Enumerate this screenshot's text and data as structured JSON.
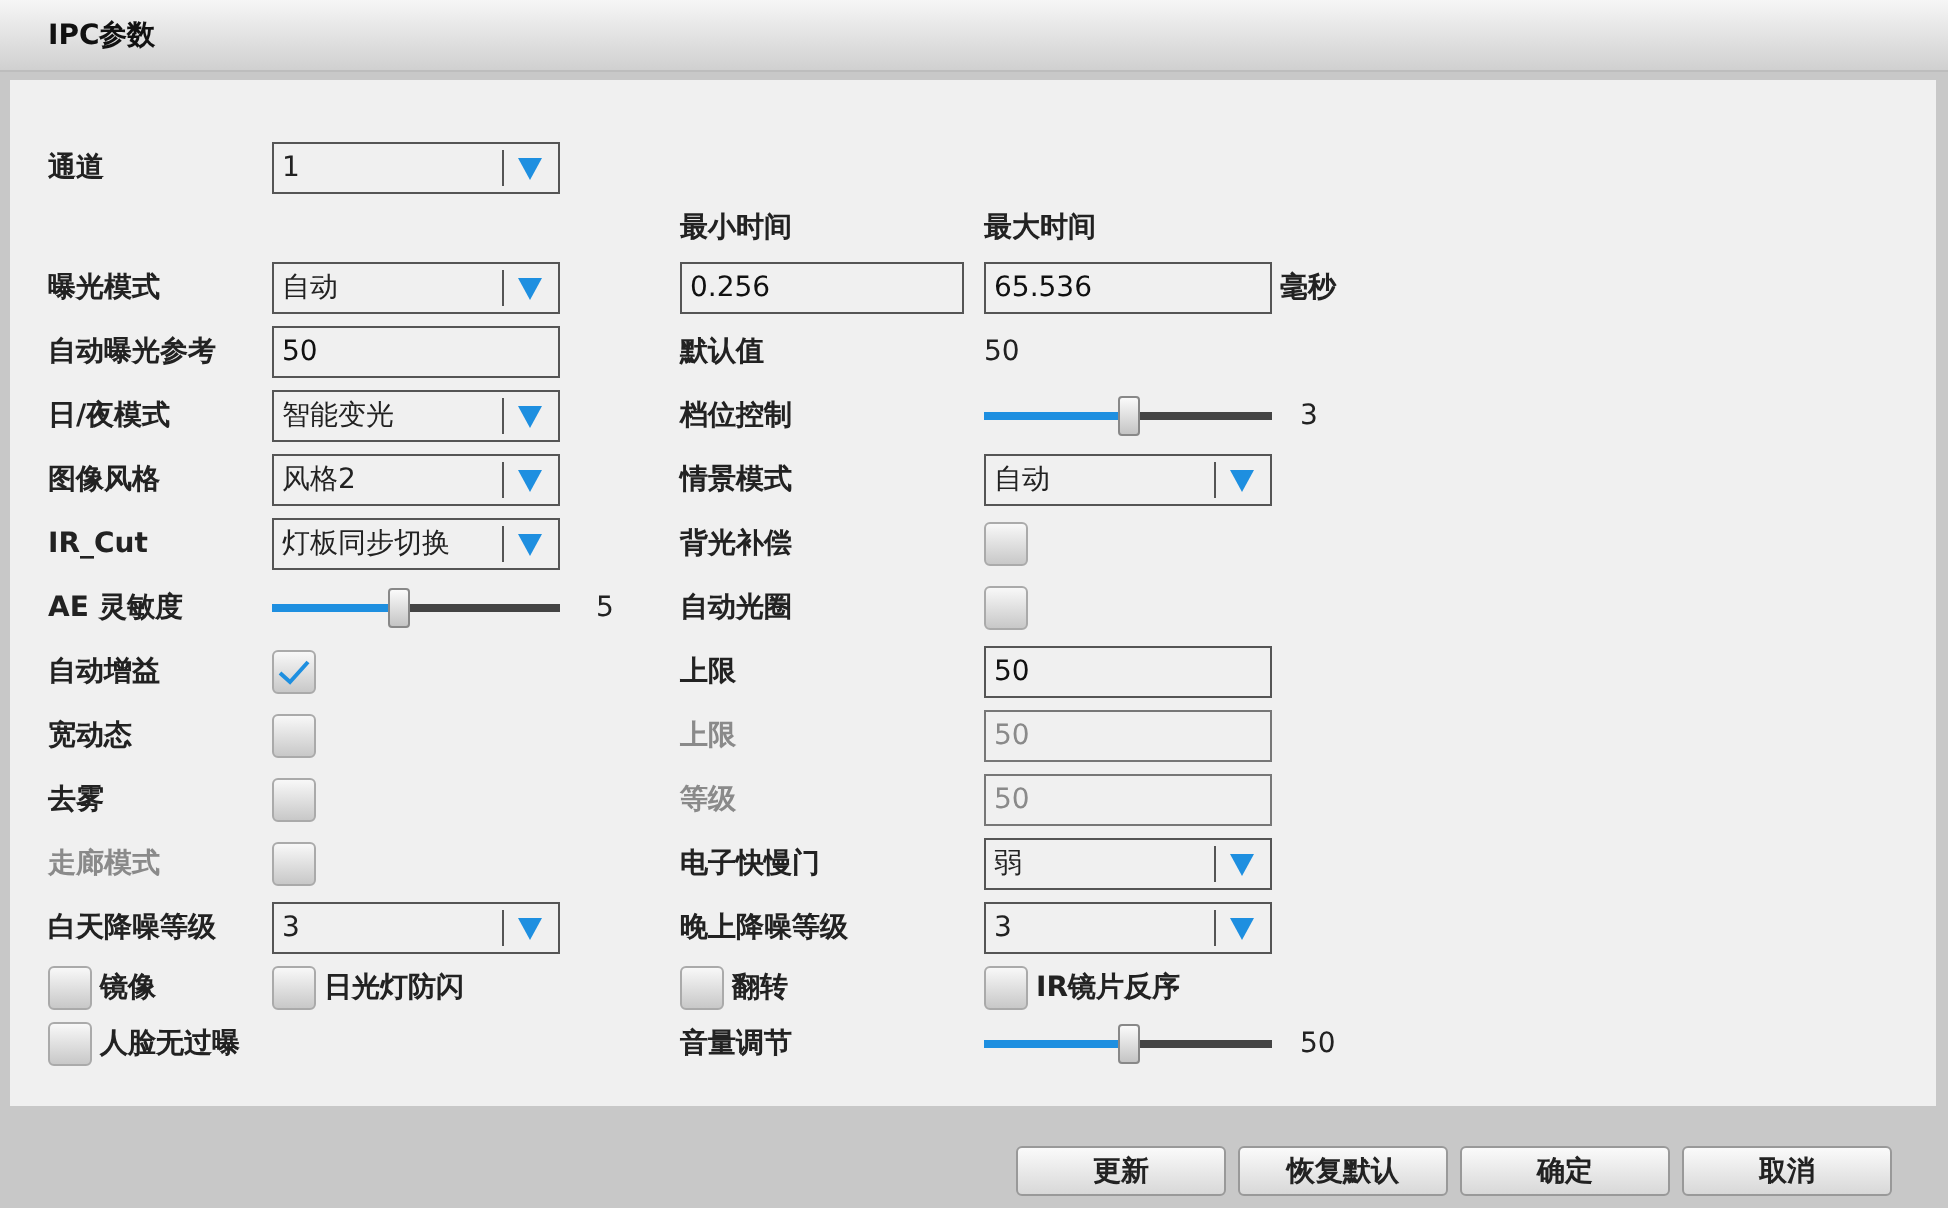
{
  "window": {
    "title": "IPC参数"
  },
  "rows": [
    {
      "left": {
        "kind": "select",
        "label": "通道",
        "value": "1"
      }
    },
    {
      "right": {
        "kind": "headers",
        "label": "最小时间",
        "value": "最大时间"
      }
    },
    {
      "left": {
        "kind": "select",
        "label": "曝光模式",
        "value": "自动"
      },
      "right": {
        "kind": "range",
        "min": "0.256",
        "max": "65.536",
        "unit": "毫秒"
      }
    },
    {
      "left": {
        "kind": "input",
        "label": "自动曝光参考",
        "value": "50",
        "disabled": false
      },
      "right": {
        "kind": "readout",
        "label": "默认值",
        "value": "50"
      }
    },
    {
      "left": {
        "kind": "select",
        "label": "日/夜模式",
        "value": "智能变光"
      },
      "right": {
        "kind": "slider",
        "label": "档位控制",
        "level": 0.5,
        "reading": "3"
      }
    },
    {
      "left": {
        "kind": "select",
        "label": "图像风格",
        "value": "风格2"
      },
      "right": {
        "kind": "select",
        "label": "情景模式",
        "value": "自动"
      }
    },
    {
      "left": {
        "kind": "select",
        "label": "IR_Cut",
        "value": "灯板同步切换"
      },
      "right": {
        "kind": "checkbox",
        "label": "背光补偿",
        "checked": false,
        "disabled": false
      }
    },
    {
      "left": {
        "kind": "slider",
        "label": "AE 灵敏度",
        "level": 0.44,
        "reading": "5"
      },
      "right": {
        "kind": "checkbox",
        "label": "自动光圈",
        "checked": false,
        "disabled": false
      }
    },
    {
      "left": {
        "kind": "checkbox",
        "label": "自动增益",
        "checked": true,
        "disabled": false
      },
      "right": {
        "kind": "input",
        "label": "上限",
        "value": "50",
        "disabled": false
      }
    },
    {
      "left": {
        "kind": "checkbox",
        "label": "宽动态",
        "checked": false,
        "disabled": false
      },
      "right": {
        "kind": "input",
        "label": "上限",
        "value": "50",
        "disabled": true
      }
    },
    {
      "left": {
        "kind": "checkbox",
        "label": "去雾",
        "checked": false,
        "disabled": false
      },
      "right": {
        "kind": "input",
        "label": "等级",
        "value": "50",
        "disabled": true
      }
    },
    {
      "left": {
        "kind": "checkbox",
        "label": "走廊模式",
        "checked": false,
        "disabled": true
      },
      "right": {
        "kind": "select",
        "label": "电子快慢门",
        "value": "弱"
      }
    },
    {
      "left": {
        "kind": "select",
        "label": "白天降噪等级",
        "value": "3"
      },
      "right": {
        "kind": "select",
        "label": "晚上降噪等级",
        "value": "3"
      }
    },
    {
      "left": {
        "kind": "checks",
        "items": [
          {
            "label": "镜像",
            "checked": false
          },
          {
            "label": "日光灯防闪",
            "checked": false
          }
        ]
      },
      "right": {
        "kind": "checks",
        "items": [
          {
            "label": "翻转",
            "checked": false
          },
          {
            "label": "IR镜片反序",
            "checked": false
          }
        ]
      }
    },
    {
      "left": {
        "kind": "checks",
        "items": [
          {
            "label": "人脸无过曝",
            "checked": false
          }
        ]
      },
      "right": {
        "kind": "slider",
        "label": "音量调节",
        "level": 0.5,
        "reading": "50"
      }
    }
  ],
  "buttons": [
    "更新",
    "恢复默认",
    "确定",
    "取消"
  ]
}
